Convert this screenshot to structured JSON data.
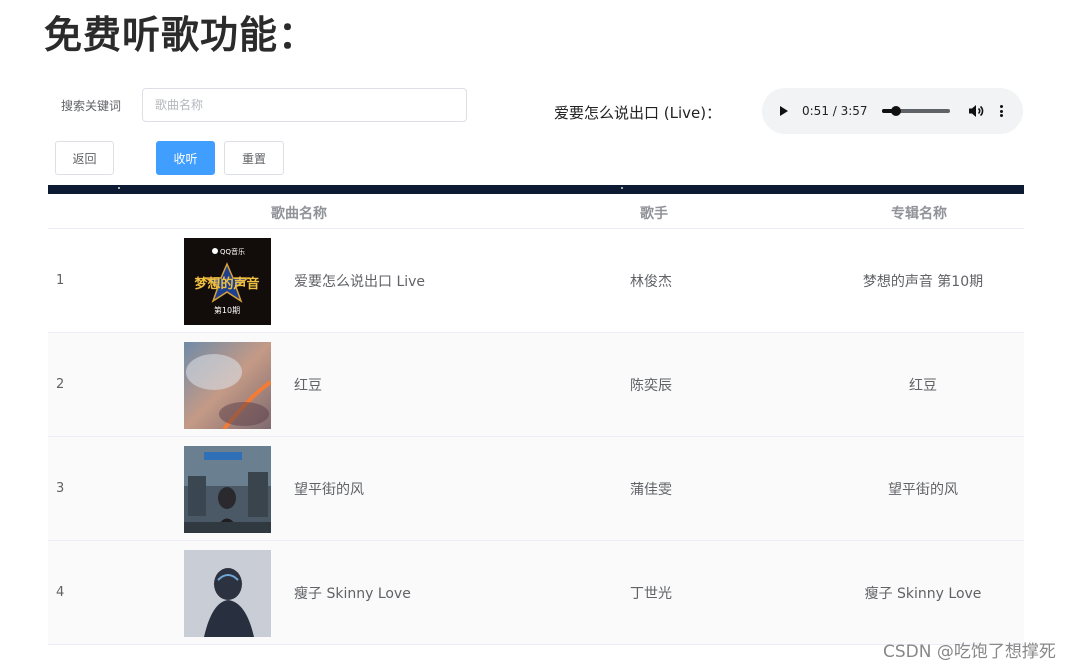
{
  "page": {
    "title": "免费听歌功能："
  },
  "search": {
    "label": "搜索关键词",
    "placeholder": "歌曲名称",
    "value": ""
  },
  "buttons": {
    "back": "返回",
    "listen": "收听",
    "reset": "重置"
  },
  "now_playing": {
    "label": "爱要怎么说出口 (Live)："
  },
  "audio": {
    "time": "0:51 / 3:57",
    "progress": 0.215,
    "volume_icon": "volume-icon",
    "more_icon": "more-vert-icon",
    "play_icon": "play-icon"
  },
  "table": {
    "headers": {
      "song": "歌曲名称",
      "singer": "歌手",
      "album": "专辑名称"
    },
    "rows": [
      {
        "index": "1",
        "song": "爱要怎么说出口 Live",
        "singer": "林俊杰",
        "album": "梦想的声音 第10期",
        "cover_text": "QQ音乐",
        "cover_title": "梦想的声音",
        "cover_episode": "第10期"
      },
      {
        "index": "2",
        "song": "红豆",
        "singer": "陈奕辰",
        "album": "红豆"
      },
      {
        "index": "3",
        "song": "望平街的风",
        "singer": "蒲佳雯",
        "album": "望平街的风"
      },
      {
        "index": "4",
        "song": "瘦子 Skinny Love",
        "singer": "丁世光",
        "album": "瘦子 Skinny Love"
      }
    ]
  },
  "watermark": "CSDN @吃饱了想撑死",
  "colors": {
    "primary": "#409eff",
    "dark_bar": "#0c1a33",
    "border": "#dcdfe6"
  }
}
